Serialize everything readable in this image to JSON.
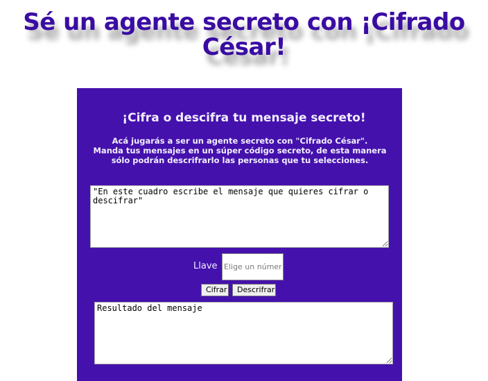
{
  "page": {
    "title": "Sé un agente secreto con ¡Cifrado César!"
  },
  "card": {
    "heading": "¡Cifra o descifra tu mensaje secreto!",
    "intro_line1": "Acá jugarás a ser un agente secreto con \"Cifrado César\".",
    "intro_line2": "Manda tus mensajes en un súper código secreto, de esta manera sólo podrán descrifrarlo las personas que tu selecciones."
  },
  "message_input": {
    "value": "\"En este cuadro escribe el mensaje que quieres cifrar o descifrar\""
  },
  "key": {
    "label": "Llave",
    "placeholder": "Elige un número."
  },
  "buttons": {
    "cipher_label": "Cifrar",
    "decipher_label": "Descrifrar"
  },
  "result_output": {
    "value": "Resultado del mensaje"
  },
  "colors": {
    "title": "#3a0ca3",
    "card_background": "#4511ad",
    "card_text": "#f2efff",
    "page_background": "#ffffff"
  }
}
